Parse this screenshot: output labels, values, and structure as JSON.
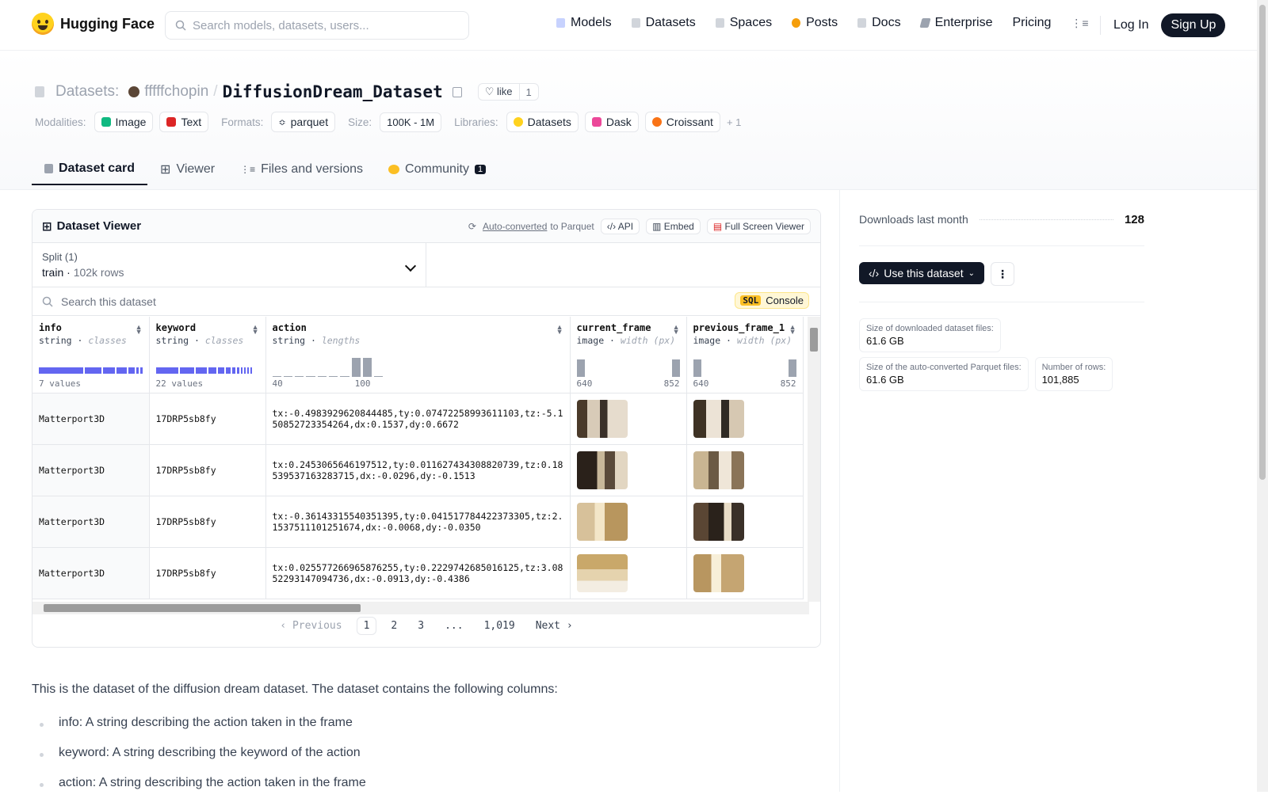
{
  "nav": {
    "brand": "Hugging Face",
    "search_placeholder": "Search models, datasets, users...",
    "links": [
      "Models",
      "Datasets",
      "Spaces",
      "Posts",
      "Docs",
      "Enterprise",
      "Pricing"
    ],
    "login": "Log In",
    "signup": "Sign Up"
  },
  "header": {
    "section": "Datasets:",
    "owner": "fffffchopin",
    "repo": "DiffusionDream_Dataset",
    "like_label": "like",
    "like_count": "1",
    "modalities_label": "Modalities:",
    "modalities": [
      "Image",
      "Text"
    ],
    "formats_label": "Formats:",
    "formats": [
      "parquet"
    ],
    "size_label": "Size:",
    "size": "100K - 1M",
    "libraries_label": "Libraries:",
    "libraries": [
      "Datasets",
      "Dask",
      "Croissant"
    ],
    "libraries_more": "+ 1"
  },
  "tabs": [
    "Dataset card",
    "Viewer",
    "Files and versions",
    "Community"
  ],
  "community_badge": "1",
  "viewer": {
    "title": "Dataset Viewer",
    "auto_converted": "Auto-converted",
    "to_parquet": "to Parquet",
    "api": "API",
    "embed": "Embed",
    "fullscreen": "Full Screen Viewer",
    "split_title": "Split (1)",
    "split_name": "train",
    "split_rows": "102k rows",
    "search_placeholder": "Search this dataset",
    "sql": "SQL",
    "console": "Console",
    "columns": [
      {
        "name": "info",
        "type": "string",
        "stat": "classes",
        "summary": "7 values"
      },
      {
        "name": "keyword",
        "type": "string",
        "stat": "classes",
        "summary": "22 values"
      },
      {
        "name": "action",
        "type": "string",
        "stat": "lengths",
        "min": "40",
        "max": "100"
      },
      {
        "name": "current_frame",
        "type": "image",
        "stat": "width (px)",
        "min": "640",
        "max": "852"
      },
      {
        "name": "previous_frame_1",
        "type": "image",
        "stat": "width (px)",
        "min": "640",
        "max": "852"
      }
    ],
    "rows": [
      {
        "info": "Matterport3D",
        "keyword": "17DRP5sb8fy",
        "action": "tx:-0.4983929620844485,ty:0.07472258993611103,tz:-5.150852723354264,dx:0.1537,dy:0.6672"
      },
      {
        "info": "Matterport3D",
        "keyword": "17DRP5sb8fy",
        "action": "tx:0.2453065646197512,ty:0.011627434308820739,tz:0.18539537163283715,dx:-0.0296,dy:-0.1513"
      },
      {
        "info": "Matterport3D",
        "keyword": "17DRP5sb8fy",
        "action": "tx:-0.36143315540351395,ty:0.041517784422373305,tz:2.1537511101251674,dx:-0.0068,dy:-0.0350"
      },
      {
        "info": "Matterport3D",
        "keyword": "17DRP5sb8fy",
        "action": "tx:0.025577266965876255,ty:0.2229742685016125,tz:3.0852293147094736,dx:-0.0913,dy:-0.4386"
      }
    ],
    "pager": {
      "prev": "Previous",
      "pages": [
        "1",
        "2",
        "3",
        "...",
        "1,019"
      ],
      "next": "Next"
    }
  },
  "sidebar": {
    "downloads_label": "Downloads last month",
    "downloads": "128",
    "use_button": "Use this dataset",
    "stats": [
      {
        "k": "Size of downloaded dataset files:",
        "v": "61.6 GB"
      },
      {
        "k": "Size of the auto-converted Parquet files:",
        "v": "61.6 GB"
      },
      {
        "k": "Number of rows:",
        "v": "101,885"
      }
    ]
  },
  "card": {
    "intro": "This is the dataset of the diffusion dream dataset. The dataset contains the following columns:",
    "bullets": [
      "info: A string describing the action taken in the frame",
      "keyword: A string describing the keyword of the action",
      "action: A string describing the action taken in the frame"
    ]
  }
}
